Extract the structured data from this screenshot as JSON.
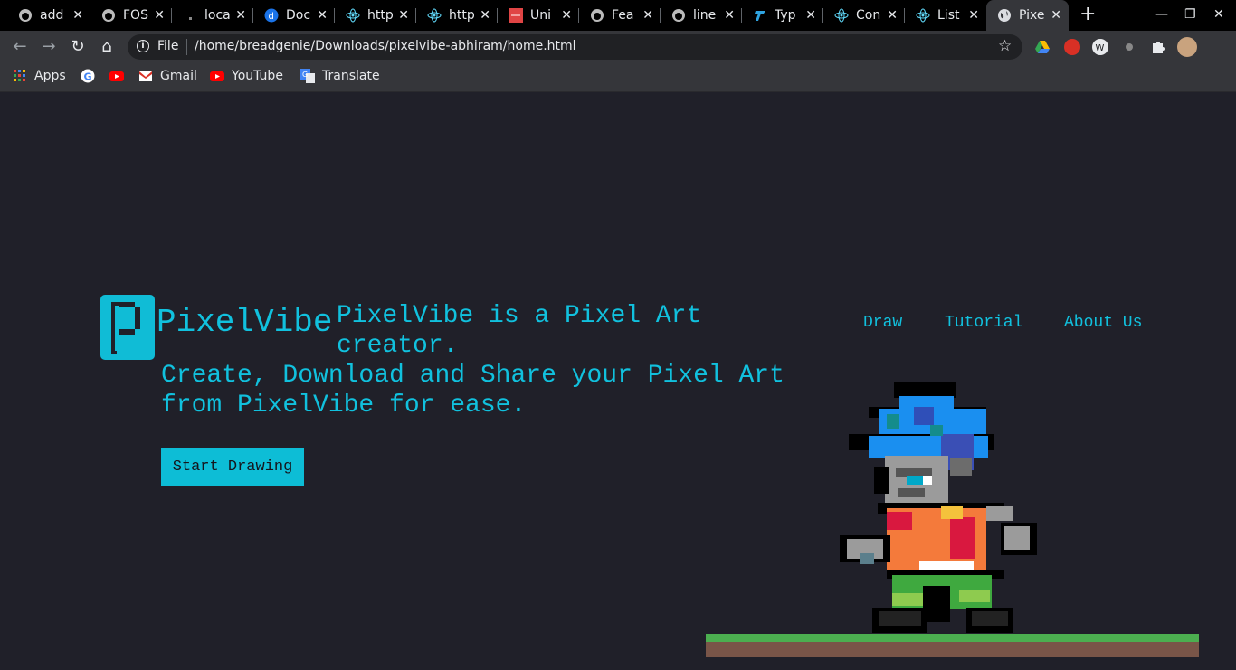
{
  "browser": {
    "tabs": [
      {
        "title": "add",
        "icon": "github-icon"
      },
      {
        "title": "FOS",
        "icon": "github-icon"
      },
      {
        "title": "loca",
        "icon": "generic-icon"
      },
      {
        "title": "Doc",
        "icon": "docs-icon"
      },
      {
        "title": "http",
        "icon": "react-icon"
      },
      {
        "title": "http",
        "icon": "react-icon"
      },
      {
        "title": "Uni",
        "icon": "unicode-icon"
      },
      {
        "title": "Fea",
        "icon": "github-icon"
      },
      {
        "title": "line",
        "icon": "github-icon"
      },
      {
        "title": "Typ",
        "icon": "typescript-icon"
      },
      {
        "title": "Con",
        "icon": "react-icon"
      },
      {
        "title": "List",
        "icon": "react-icon"
      },
      {
        "title": "Pixe",
        "icon": "globe-icon"
      }
    ],
    "omnibox": {
      "scheme_label": "File",
      "url": "/home/breadgenie/Downloads/pixelvibe-abhiram/home.html"
    },
    "bookmarks": [
      {
        "label": "Apps",
        "icon": "apps-grid-icon"
      },
      {
        "label": "",
        "icon": "google-icon"
      },
      {
        "label": "",
        "icon": "youtube-icon"
      },
      {
        "label": "Gmail",
        "icon": "gmail-icon"
      },
      {
        "label": "YouTube",
        "icon": "youtube-icon"
      },
      {
        "label": "Translate",
        "icon": "translate-icon"
      }
    ]
  },
  "site": {
    "brand": "PixelVibe",
    "headline": "PixelVibe is a Pixel Art creator.",
    "subline": "Create, Download and Share your Pixel Art from PixelVibe for ease.",
    "cta_label": "Start Drawing",
    "nav": [
      "Draw",
      "Tutorial",
      "About Us"
    ]
  },
  "colors": {
    "page_bg": "#202029",
    "accent": "#11c1de",
    "button_bg": "#0dbdd6",
    "chrome_dark": "#35363a"
  }
}
